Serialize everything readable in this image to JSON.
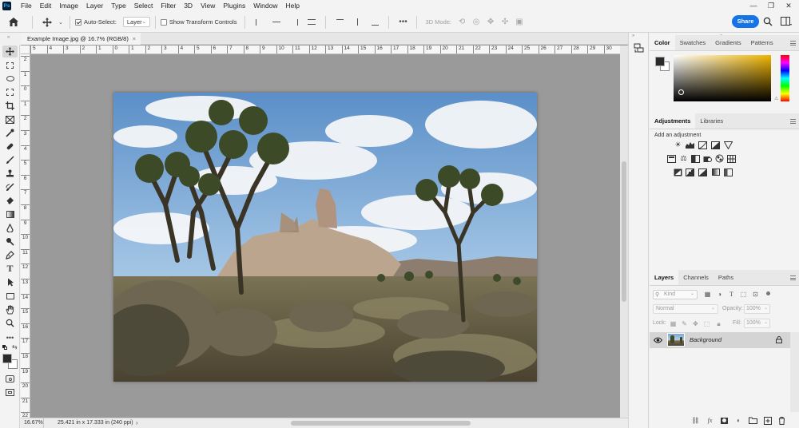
{
  "menubar": {
    "logo": "Ps",
    "items": [
      "File",
      "Edit",
      "Image",
      "Layer",
      "Type",
      "Select",
      "Filter",
      "3D",
      "View",
      "Plugins",
      "Window",
      "Help"
    ]
  },
  "options_bar": {
    "auto_select_label": "Auto-Select:",
    "auto_select_checked": true,
    "layer_dropdown": "Layer",
    "show_transform_label": "Show Transform Controls",
    "show_transform_checked": false,
    "mode_3d_label": "3D Mode:",
    "share_label": "Share"
  },
  "document": {
    "tab_title": "Example Image.jpg @ 16.7% (RGB/8)",
    "zoom": "16.67%",
    "status": "25.421 in x 17.333 in (240 ppi)",
    "hruler_labels": [
      "5",
      "4",
      "3",
      "2",
      "1",
      "0",
      "1",
      "2",
      "3",
      "4",
      "5",
      "6",
      "7",
      "8",
      "9",
      "10",
      "11",
      "12",
      "13",
      "14",
      "15",
      "16",
      "17",
      "18",
      "19",
      "20",
      "21",
      "22",
      "23",
      "24",
      "25",
      "26",
      "27",
      "28",
      "29",
      "30"
    ],
    "vruler_labels": [
      "2",
      "1",
      "0",
      "1",
      "2",
      "3",
      "4",
      "5",
      "6",
      "7",
      "8",
      "9",
      "10",
      "11",
      "12",
      "13",
      "14",
      "15",
      "16",
      "17",
      "18",
      "19",
      "20",
      "21",
      "22"
    ]
  },
  "color_panel": {
    "tabs": [
      "Color",
      "Swatches",
      "Gradients",
      "Patterns"
    ],
    "active_tab": "Color",
    "hue_color": "#f0b400",
    "foreground": "#2a2a2a",
    "background": "#ffffff"
  },
  "adjustments_panel": {
    "tabs": [
      "Adjustments",
      "Libraries"
    ],
    "active_tab": "Adjustments",
    "hint": "Add an adjustment"
  },
  "layers_panel": {
    "tabs": [
      "Layers",
      "Channels",
      "Paths"
    ],
    "active_tab": "Layers",
    "filter_placeholder": "Kind",
    "blend_mode": "Normal",
    "opacity_label": "Opacity:",
    "opacity_value": "100%",
    "lock_label": "Lock:",
    "fill_label": "Fill:",
    "fill_value": "100%",
    "layers": [
      {
        "name": "Background",
        "visible": true,
        "locked": true
      }
    ]
  }
}
